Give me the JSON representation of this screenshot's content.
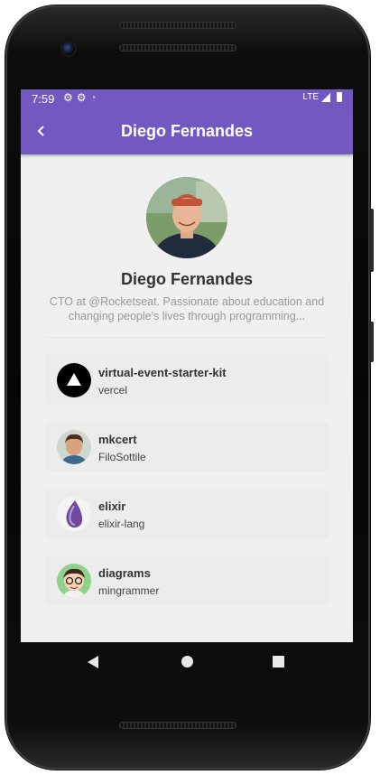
{
  "status_bar": {
    "time": "7:59",
    "network": "LTE"
  },
  "app_bar": {
    "title": "Diego Fernandes",
    "back_icon": "chevron-left-icon",
    "color": "#7159c1"
  },
  "profile": {
    "name": "Diego Fernandes",
    "bio_line1": "CTO at @Rocketseat. Passionate about education and",
    "bio_line2": "changing people's lives through programming..."
  },
  "repositories": [
    {
      "title": "virtual-event-starter-kit",
      "owner": "vercel",
      "avatar_icon": "vercel-logo-icon"
    },
    {
      "title": "mkcert",
      "owner": "FiloSottile",
      "avatar_icon": "user-avatar-icon"
    },
    {
      "title": "elixir",
      "owner": "elixir-lang",
      "avatar_icon": "elixir-drop-icon"
    },
    {
      "title": "diagrams",
      "owner": "mingrammer",
      "avatar_icon": "cartoon-avatar-icon"
    }
  ]
}
